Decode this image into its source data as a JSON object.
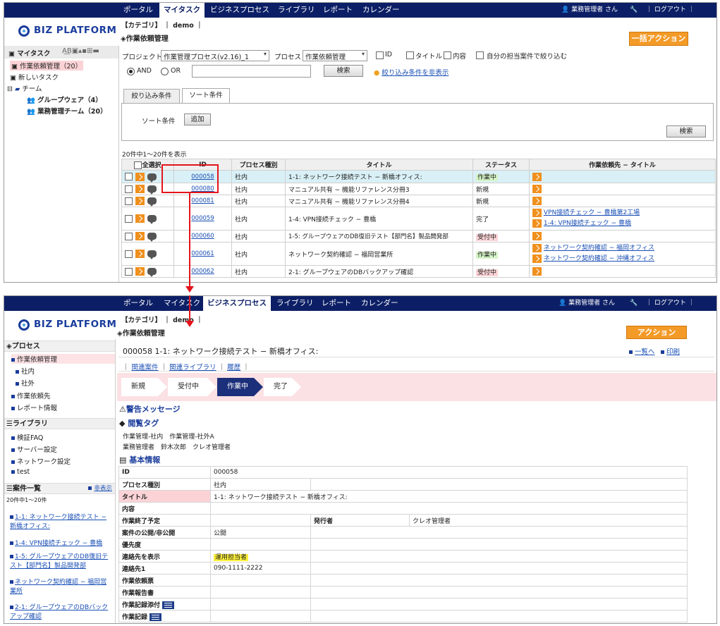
{
  "nav": {
    "items": [
      "ポータル",
      "マイタスク",
      "ビジネスプロセス",
      "ライブラリ",
      "レポート",
      "カレンダー"
    ],
    "user": "業務管理者 さん",
    "logout": "ログアウト"
  },
  "logo": "BIZ PLATFORM",
  "breadcrumb": "【カテゴリ】 ｜ demo ｜",
  "page_title": "作業依頼管理",
  "screen1": {
    "bulk_action": "一括アクション",
    "sidebar": {
      "title": "マイタスク",
      "items": [
        "作業依頼管理（20）",
        "新しいタスク",
        "チーム",
        "グループウェア（4）",
        "業務管理チーム（20）"
      ]
    },
    "filter": {
      "project_label": "プロジェクト",
      "project_value": "作業管理プロセス(v2.16)_1",
      "process_label": "プロセス",
      "process_value": "作業依頼管理",
      "chk_id": "ID",
      "chk_title": "タイトル",
      "chk_content": "内容",
      "chk_mine": "自分の担当案件で絞り込む",
      "and": "AND",
      "or": "OR",
      "search": "検索",
      "hide_link": "絞り込み条件を非表示"
    },
    "tabs": [
      "絞り込み条件",
      "ソート条件"
    ],
    "sort_label": "ソート条件",
    "add_button": "追加",
    "search2": "検索",
    "count": "20件中1～20件を表示",
    "columns": [
      "全選択",
      "ID",
      "プロセス種別",
      "タイトル",
      "ステータス",
      "作業依頼先 − タイトル"
    ],
    "rows": [
      {
        "id": "000058",
        "type": "社内",
        "title": "1-1: ネットワーク接続テスト − 新橋オフィス:",
        "status": "作業中",
        "refs": []
      },
      {
        "id": "000080",
        "type": "社内",
        "title": "マニュアル共有 − 機能リファレンス分冊3",
        "status": "新規",
        "refs": []
      },
      {
        "id": "000081",
        "type": "社内",
        "title": "マニュアル共有 − 機能リファレンス分冊4",
        "status": "新規",
        "refs": []
      },
      {
        "id": "000059",
        "type": "社内",
        "title": "1-4: VPN接続チェック − 豊橋",
        "status": "完了",
        "refs": [
          "VPN接続チェック − 豊橋第2工場",
          "1-4: VPN接続チェック − 豊橋"
        ]
      },
      {
        "id": "000060",
        "type": "社内",
        "title": "1-5: グループウェアのDB復旧テスト【部門名】製品開発部",
        "status": "受付中",
        "refs": []
      },
      {
        "id": "000061",
        "type": "社内",
        "title": "ネットワーク契約確認 − 福岡営業所",
        "status": "作業中",
        "refs": [
          "ネットワーク契約確認 − 福岡オフィス",
          "ネットワーク契約確認 − 沖縄オフィス"
        ]
      },
      {
        "id": "000062",
        "type": "社内",
        "title": "2-1: グループウェアのDBバックアップ確認",
        "status": "受付中",
        "refs": []
      }
    ]
  },
  "screen2": {
    "action": "アクション",
    "sidebar": {
      "process_head": "プロセス",
      "process_items": [
        "作業依頼管理",
        "社内",
        "社外",
        "作業依頼先",
        "レポート情報"
      ],
      "library_head": "ライブラリ",
      "library_items": [
        "検証FAQ",
        "サーバー設定",
        "ネットワーク設定",
        "test"
      ],
      "list_head": "案件一覧",
      "hide": "非表示",
      "count": "20件中1～20件",
      "links": [
        "1-1: ネットワーク接続テスト − 新橋オフィス:",
        "1-4: VPN接続チェック − 豊橋",
        "1-5: グループウェアのDB復旧テスト【部門名】製品開発部",
        "ネットワーク契約確認 − 福岡営業所",
        "2-1: グループウェアのDBバックアップ確認"
      ]
    },
    "heading": "000058 1-1: ネットワーク接続テスト − 新橋オフィス:",
    "to_list": "一覧へ",
    "print": "印刷",
    "subnav": [
      "関連案件",
      "関連ライブラリ",
      "履歴"
    ],
    "flow": [
      "新規",
      "受付中",
      "作業中",
      "完了"
    ],
    "warning": "警告メッセージ",
    "tags_head": "閲覧タグ",
    "tags_line1": "作業管理-社内　作業管理-社外A",
    "tags_line2": "業務管理者　鈴木次郎　クレオ管理者",
    "basic_head": "基本情報",
    "fields": [
      {
        "k": "ID",
        "v": "000058"
      },
      {
        "k": "プロセス種別",
        "v": "社内"
      },
      {
        "k": "タイトル",
        "v": "1-1: ネットワーク接続テスト − 新橋オフィス:"
      },
      {
        "k": "内容",
        "v": ""
      },
      {
        "k": "作業終了予定",
        "v": "",
        "k2": "発行者",
        "v2": "クレオ管理者"
      },
      {
        "k": "案件の公開/非公開",
        "v": "公開"
      },
      {
        "k": "優先度",
        "v": ""
      },
      {
        "k": "連絡先を表示",
        "v": "運用担当者"
      },
      {
        "k": "連絡先1",
        "v": "090-1111-2222"
      },
      {
        "k": "作業依頼票",
        "v": ""
      },
      {
        "k": "作業報告書",
        "v": ""
      },
      {
        "k": "作業記録添付",
        "v": ""
      },
      {
        "k": "作業記録",
        "v": ""
      }
    ]
  }
}
